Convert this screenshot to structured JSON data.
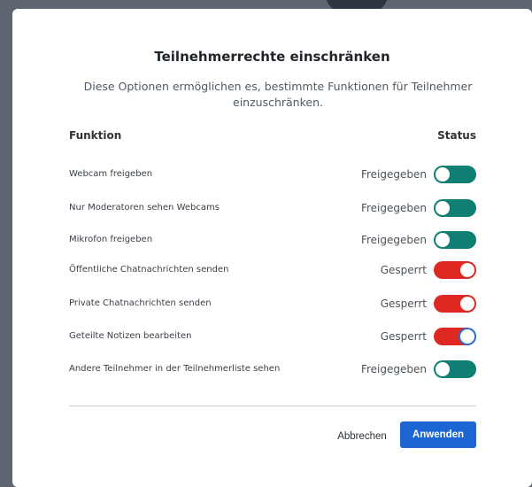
{
  "modal": {
    "title": "Teilnehmerrechte einschränken",
    "description": "Diese Optionen ermöglichen es, bestimmte Funktionen für Teilnehmer einzuschränken.",
    "col_function": "Funktion",
    "col_status": "Status",
    "rows": [
      {
        "label": "Webcam freigeben",
        "status": "Freigegeben",
        "enabled": true
      },
      {
        "label": "Nur Moderatoren sehen Webcams",
        "status": "Freigegeben",
        "enabled": true
      },
      {
        "label": "Mikrofon freigeben",
        "status": "Freigegeben",
        "enabled": true
      },
      {
        "label": "Öffentliche Chatnachrichten senden",
        "status": "Gesperrt",
        "enabled": false
      },
      {
        "label": "Private Chatnachrichten senden",
        "status": "Gesperrt",
        "enabled": false
      },
      {
        "label": "Geteilte Notizen bearbeiten",
        "status": "Gesperrt",
        "enabled": false
      },
      {
        "label": "Andere Teilnehmer in der Teilnehmerliste sehen",
        "status": "Freigegeben",
        "enabled": true
      }
    ],
    "cancel_label": "Abbrechen",
    "apply_label": "Anwenden"
  },
  "colors": {
    "toggle_on": "#0e7f72",
    "toggle_off": "#df2721",
    "primary_button": "#1b66d2",
    "focus_ring": "#2f6fd6"
  }
}
